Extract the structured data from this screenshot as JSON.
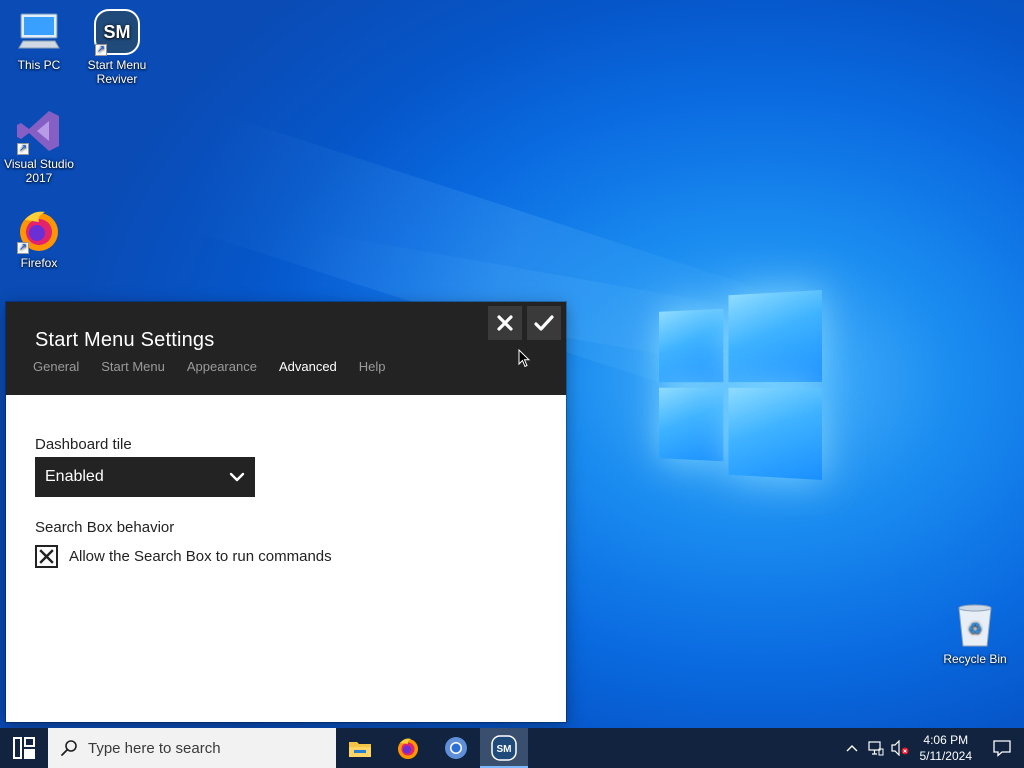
{
  "desktop": {
    "icons": [
      {
        "label": "This PC",
        "icon": "computer-icon"
      },
      {
        "label": "Start Menu Reviver",
        "icon": "start-menu-reviver-icon",
        "badge": "SM"
      },
      {
        "label": "Visual Studio 2017",
        "icon": "visual-studio-icon"
      },
      {
        "label": "Firefox",
        "icon": "firefox-icon"
      },
      {
        "label": "Recycle Bin",
        "icon": "recycle-bin-icon"
      }
    ]
  },
  "dialog": {
    "title": "Start Menu Settings",
    "tabs": [
      "General",
      "Start Menu",
      "Appearance",
      "Advanced",
      "Help"
    ],
    "active_tab": "Advanced",
    "close_icon": "close-icon",
    "confirm_icon": "check-icon",
    "dashboard_label": "Dashboard tile",
    "dashboard_value": "Enabled",
    "search_label": "Search Box behavior",
    "search_checkbox_label": "Allow the Search Box to run commands",
    "search_checkbox_checked": true
  },
  "taskbar": {
    "search_placeholder": "Type here to search",
    "apps": [
      "file-explorer-icon",
      "firefox-icon",
      "chrome-icon",
      "start-menu-reviver-icon"
    ],
    "active_app": "start-menu-reviver-icon",
    "time": "4:06 PM",
    "date": "5/11/2024"
  },
  "colors": {
    "dialog_header": "#232323",
    "taskbar": "#11233f",
    "desktop_blue": "#0a6ae0"
  }
}
